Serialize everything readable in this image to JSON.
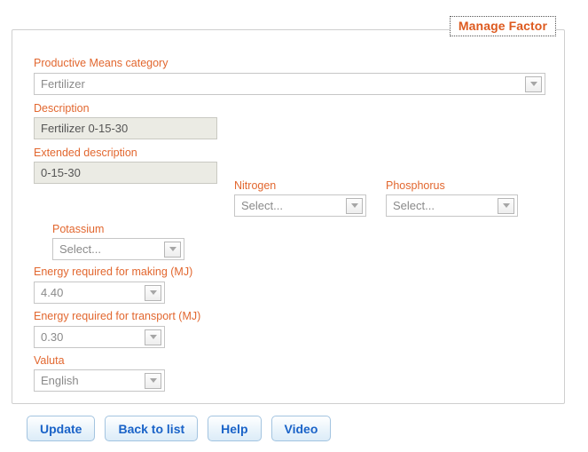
{
  "panel": {
    "legend": "Manage Factor"
  },
  "fields": {
    "category": {
      "label": "Productive Means category",
      "value": "Fertilizer",
      "icon": "chevron-down-icon"
    },
    "description": {
      "label": "Description",
      "value": "Fertilizer 0-15-30"
    },
    "extended_description": {
      "label": "Extended description",
      "value": "0-15-30"
    },
    "nitrogen": {
      "label": "Nitrogen",
      "value": "Select...",
      "icon": "chevron-down-icon"
    },
    "phosphorus": {
      "label": "Phosphorus",
      "value": "Select...",
      "icon": "chevron-down-icon"
    },
    "potassium": {
      "label": "Potassium",
      "value": "Select...",
      "icon": "chevron-down-icon"
    },
    "energy_making": {
      "label": "Energy required for making (MJ)",
      "value": "4.40",
      "icon": "chevron-down-icon"
    },
    "energy_transport": {
      "label": "Energy required for transport (MJ)",
      "value": "0.30",
      "icon": "chevron-down-icon"
    },
    "valuta": {
      "label": "Valuta",
      "value": "English",
      "icon": "chevron-down-icon"
    }
  },
  "buttons": [
    {
      "label": "Update",
      "name": "update-button"
    },
    {
      "label": "Back to list",
      "name": "back-to-list-button"
    },
    {
      "label": "Help",
      "name": "help-button"
    },
    {
      "label": "Video",
      "name": "video-button"
    }
  ],
  "colors": {
    "label_orange": "#e2672f",
    "legend_orange": "#dd5a1f",
    "button_blue": "#1a63c8",
    "readonly_bg": "#ebebe4"
  }
}
